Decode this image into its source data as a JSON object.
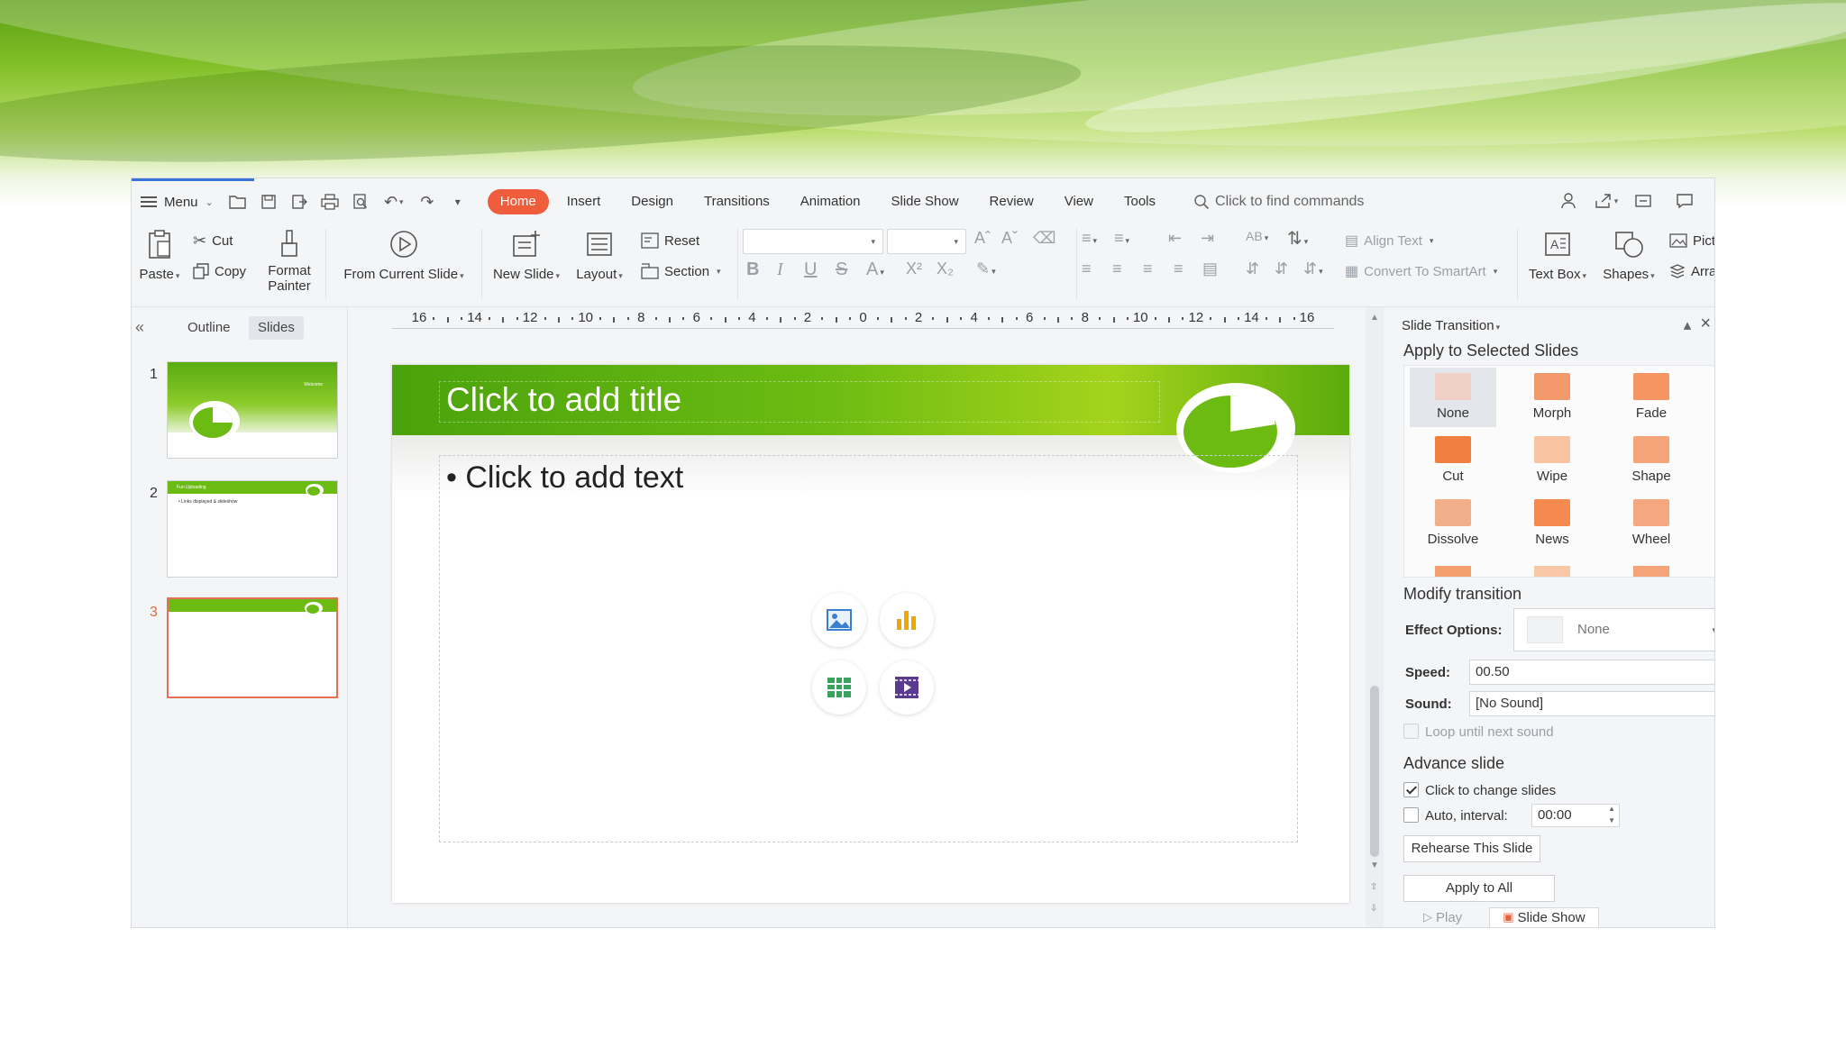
{
  "menu": {
    "menu_label": "Menu",
    "tabs": [
      {
        "label": "Home",
        "active": true
      },
      {
        "label": "Insert"
      },
      {
        "label": "Design"
      },
      {
        "label": "Transitions"
      },
      {
        "label": "Animation"
      },
      {
        "label": "Slide Show"
      },
      {
        "label": "Review"
      },
      {
        "label": "View"
      },
      {
        "label": "Tools"
      }
    ],
    "find_placeholder": "Click to find commands"
  },
  "ribbon": {
    "paste": "Paste",
    "cut": "Cut",
    "copy": "Copy",
    "format_painter_1": "Format",
    "format_painter_2": "Painter",
    "from_current_slide": "From Current Slide",
    "new_slide": "New Slide",
    "layout": "Layout",
    "reset": "Reset",
    "section": "Section",
    "align_text": "Align Text",
    "convert_smartart": "Convert To SmartArt",
    "text_box": "Text Box",
    "shapes": "Shapes",
    "picture": "Pict",
    "arrange": "Arra"
  },
  "left_panel": {
    "tab_outline": "Outline",
    "tab_slides": "Slides",
    "slides": [
      {
        "number": "1",
        "mini_title": "Welcome"
      },
      {
        "number": "2",
        "mini_title": "Fun Uploading",
        "mini_bullet": "• Links displayed & slideshow"
      },
      {
        "number": "3"
      }
    ],
    "selected_slide": 3
  },
  "ruler": {
    "labels": [
      "16",
      "14",
      "12",
      "10",
      "8",
      "6",
      "4",
      "2",
      "0",
      "2",
      "4",
      "6",
      "8",
      "10",
      "12",
      "14",
      "16"
    ]
  },
  "slide": {
    "title_placeholder": "Click to add title",
    "body_placeholder": "Click to add text",
    "insert_icons": [
      "picture-icon",
      "chart-icon",
      "table-icon",
      "video-icon"
    ],
    "band_color": "#6cbb12"
  },
  "transition_pane": {
    "header": "Slide Transition",
    "apply_selected": "Apply to Selected Slides",
    "transitions": [
      {
        "label": "None",
        "selected": true,
        "color": "#f0cfc4"
      },
      {
        "label": "Morph",
        "color": "#f29a6b"
      },
      {
        "label": "Fade",
        "color": "#f59561"
      },
      {
        "label": "Cut",
        "color": "#f0803f"
      },
      {
        "label": "Wipe",
        "color": "#f7c3a1"
      },
      {
        "label": "Shape",
        "color": "#f5a47a"
      },
      {
        "label": "Dissolve",
        "color": "#f2b08a"
      },
      {
        "label": "News",
        "color": "#f58a50"
      },
      {
        "label": "Wheel",
        "color": "#f5a880"
      }
    ],
    "modify_transition": "Modify transition",
    "effect_options_label": "Effect Options:",
    "effect_options_value": "None",
    "speed_label": "Speed:",
    "speed_value": "00.50",
    "sound_label": "Sound:",
    "sound_value": "[No Sound]",
    "loop_label": "Loop until next sound",
    "advance_slide": "Advance slide",
    "click_to_change": "Click to change slides",
    "click_to_change_checked": true,
    "auto_interval_label": "Auto, interval:",
    "auto_interval_value": "00:00",
    "auto_interval_checked": false,
    "rehearse": "Rehearse This Slide",
    "apply_all": "Apply to All",
    "play": "Play",
    "slide_show": "Slide Show"
  },
  "colors": {
    "accent_tab": "#ef5d3c",
    "selection_border": "#e57155",
    "slide_green": "#6cbb12"
  }
}
